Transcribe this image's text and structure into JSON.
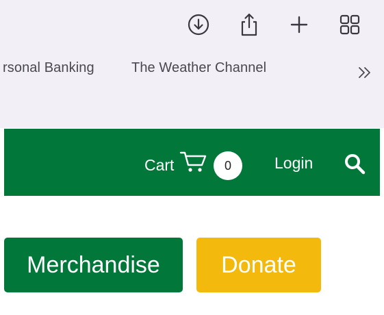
{
  "browser": {
    "toolbar": {
      "icons": [
        "download-icon",
        "share-icon",
        "new-tab-icon",
        "tab-overview-icon"
      ]
    },
    "bookmarks": [
      {
        "label": "rsonal Banking"
      },
      {
        "label": "The Weather Channel"
      }
    ],
    "more_icon": "chevron-double-right-icon"
  },
  "site": {
    "colors": {
      "brand_green": "#01783a",
      "donate_yellow": "#f3b90c"
    },
    "nav": {
      "cart_label": "Cart",
      "cart_count": "0",
      "login_label": "Login",
      "search_icon": "search-icon"
    },
    "buttons": {
      "merchandise": "Merchandise",
      "donate": "Donate"
    }
  }
}
